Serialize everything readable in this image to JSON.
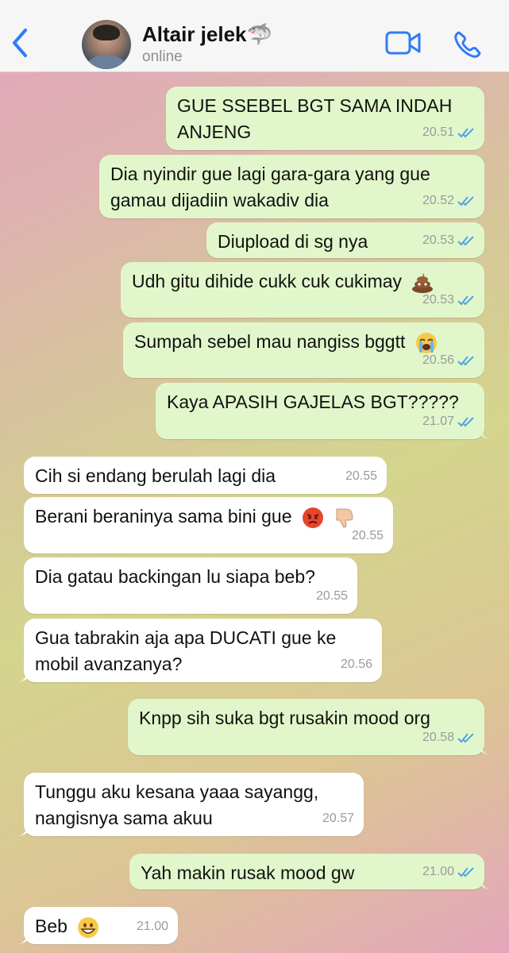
{
  "header": {
    "contact_name": "Altair jelek🦈",
    "status": "online"
  },
  "icons": {
    "back": "chevron-left-icon",
    "video": "video-camera-icon",
    "call": "phone-icon"
  },
  "colors": {
    "accent": "#2f7cf6",
    "outgoing_bubble": "#e1f7cb",
    "incoming_bubble": "#ffffff",
    "read_ticks": "#4fa3e0"
  },
  "messages": [
    {
      "dir": "out",
      "text": "GUE SSEBEL BGT SAMA INDAH\nANJENG",
      "time": "20.51",
      "status": "read"
    },
    {
      "dir": "out",
      "text": "Dia nyindir gue lagi gara-gara yang gue\ngamau dijadiin wakadiv dia",
      "time": "20.52",
      "status": "read"
    },
    {
      "dir": "out",
      "text": "Diupload di sg nya",
      "time": "20.53",
      "status": "read"
    },
    {
      "dir": "out",
      "text": "Udh gitu dihide cukk cuk cukimay",
      "emoji": "pile-of-poo-emoji",
      "time": "20.53",
      "status": "read"
    },
    {
      "dir": "out",
      "text": "Sumpah sebel mau nangiss bggtt",
      "emoji": "loudly-crying-face-emoji",
      "time": "20.56",
      "status": "read"
    },
    {
      "dir": "out",
      "text": "Kaya APASIH GAJELAS BGT?????",
      "time": "21.07",
      "status": "read"
    },
    {
      "dir": "in",
      "text": "Cih si endang berulah lagi dia",
      "time": "20.55"
    },
    {
      "dir": "in",
      "text": "Berani beraninya sama bini gue",
      "emoji": "pouting-face-thumbs-down-emoji",
      "time": "20.55"
    },
    {
      "dir": "in",
      "text": "Dia gatau backingan lu siapa beb?",
      "time": "20.55"
    },
    {
      "dir": "in",
      "text": "Gua tabrakin aja apa DUCATI gue ke\nmobil avanzanya?",
      "time": "20.56"
    },
    {
      "dir": "out",
      "text": "Knpp sih suka bgt rusakin mood org",
      "time": "20.58",
      "status": "read"
    },
    {
      "dir": "in",
      "text": "Tunggu aku kesana yaaa sayangg,\nnangisnya sama akuu",
      "time": "20.57"
    },
    {
      "dir": "out",
      "text": "Yah makin rusak mood gw",
      "time": "21.00",
      "status": "read"
    },
    {
      "dir": "in",
      "text": "Beb",
      "emoji": "grinning-face-emoji",
      "time": "21.00"
    }
  ]
}
